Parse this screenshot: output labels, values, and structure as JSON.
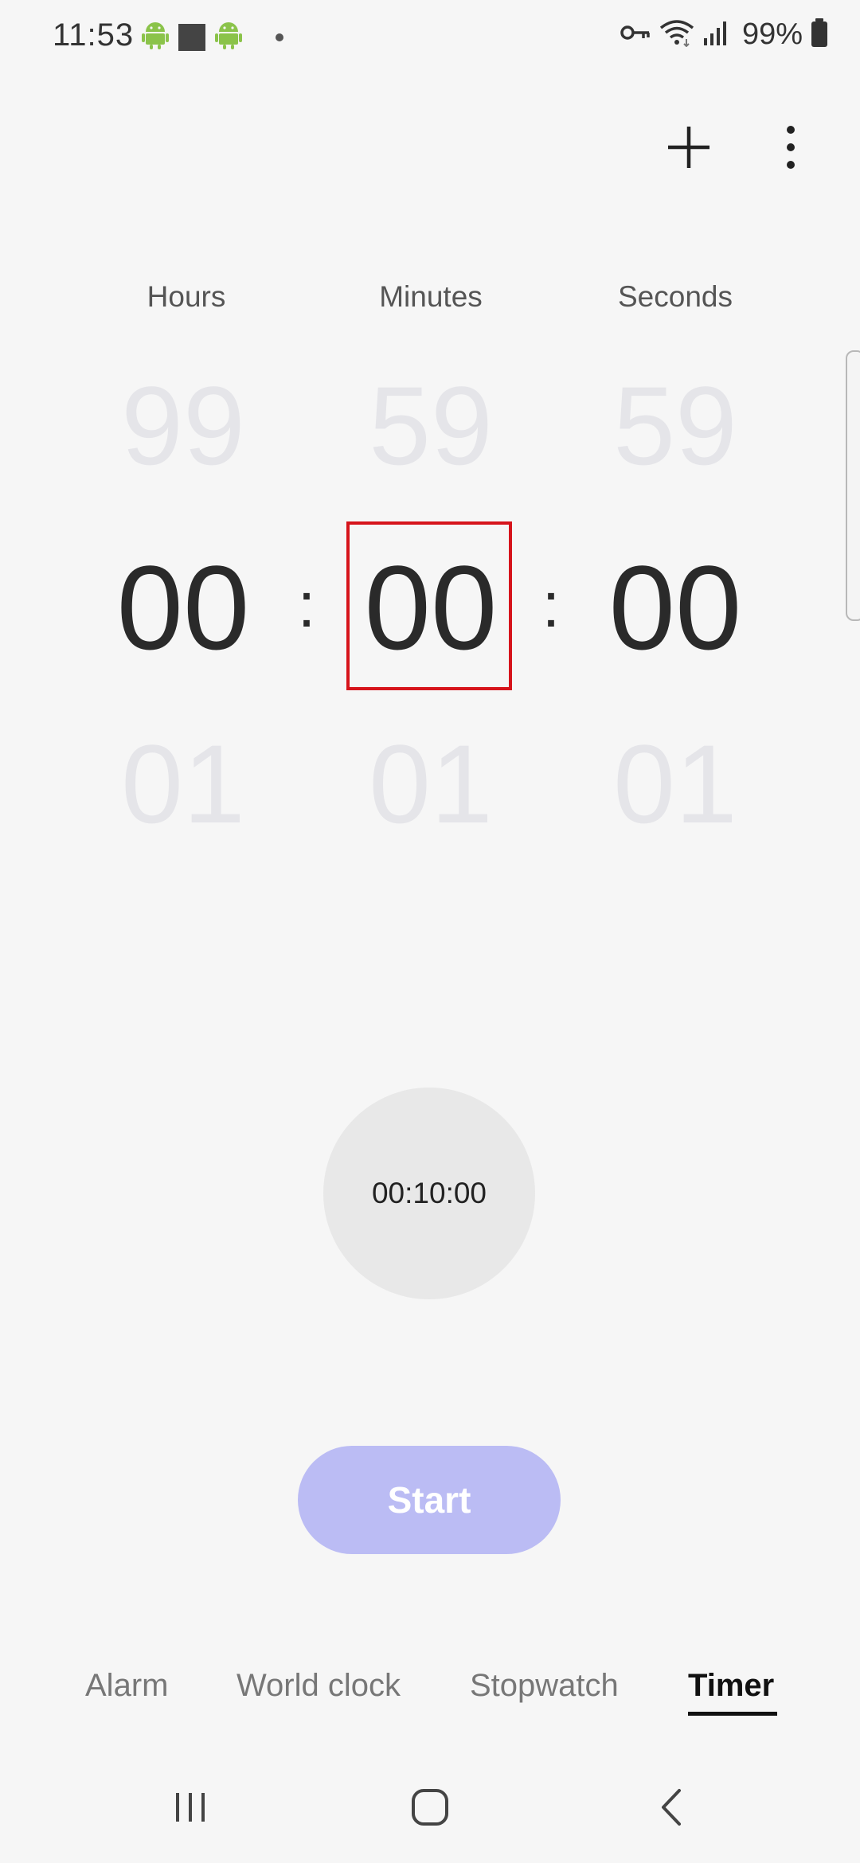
{
  "status_bar": {
    "time": "11:53",
    "battery": "99%",
    "icons": [
      "android-icon",
      "square-icon",
      "android-icon",
      "dot-icon",
      "vpn-key-icon",
      "wifi-icon",
      "signal-icon",
      "battery-icon"
    ]
  },
  "header": {
    "icons": [
      "plus-icon",
      "more-options-icon"
    ]
  },
  "picker": {
    "labels": {
      "hours": "Hours",
      "minutes": "Minutes",
      "seconds": "Seconds"
    },
    "above": {
      "hours": "99",
      "minutes": "59",
      "seconds": "59"
    },
    "current": {
      "hours": "00",
      "minutes": "00",
      "seconds": "00"
    },
    "below": {
      "hours": "01",
      "minutes": "01",
      "seconds": "01"
    },
    "separator": ":"
  },
  "preset": {
    "label": "00:10:00"
  },
  "start_button": {
    "label": "Start",
    "color": "#bbbcf4"
  },
  "tabs": [
    {
      "label": "Alarm",
      "active": false
    },
    {
      "label": "World clock",
      "active": false
    },
    {
      "label": "Stopwatch",
      "active": false
    },
    {
      "label": "Timer",
      "active": true
    }
  ],
  "navbar": {
    "icons": [
      "recent-apps-icon",
      "home-icon",
      "back-icon"
    ]
  },
  "colors": {
    "focus_outline": "#d6141b",
    "background": "#f6f6f6"
  }
}
